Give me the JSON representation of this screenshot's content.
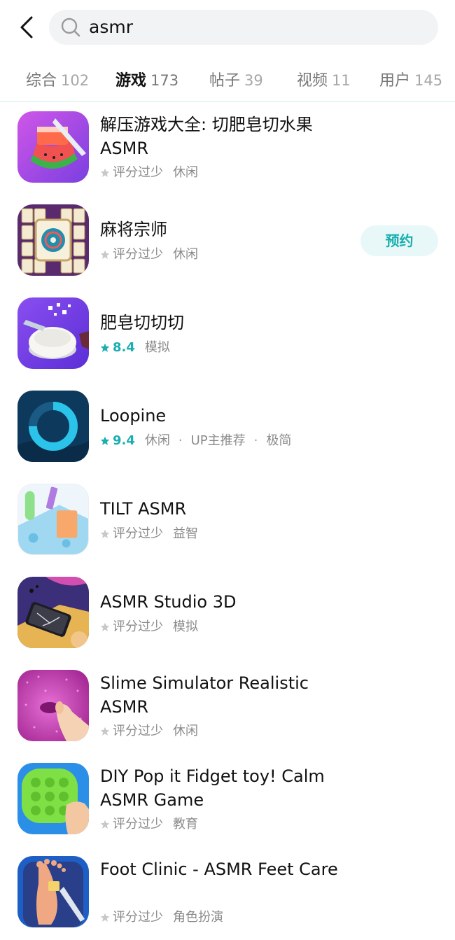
{
  "search": {
    "value": "asmr"
  },
  "tabs": [
    {
      "label": "综合",
      "count": "102"
    },
    {
      "label": "游戏",
      "count": "173"
    },
    {
      "label": "帖子",
      "count": "39"
    },
    {
      "label": "视频",
      "count": "11"
    },
    {
      "label": "用户",
      "count": "145"
    }
  ],
  "active_tab_index": 1,
  "accent_color": "#1aaeb0",
  "items": [
    {
      "name": "解压游戏大全: 切肥皂切水果 ASMR",
      "rating_text": "评分过少",
      "tags": [
        "休闲"
      ],
      "icon": "watermelon-cut-icon"
    },
    {
      "name": "麻将宗师",
      "rating_text": "评分过少",
      "tags": [
        "休闲"
      ],
      "action": "预约",
      "icon": "mahjong-icon"
    },
    {
      "name": "肥皂切切切",
      "rating": "8.4",
      "tags": [
        "模拟"
      ],
      "icon": "soap-cut-icon"
    },
    {
      "name": "Loopine",
      "rating": "9.4",
      "tags": [
        "休闲",
        "UP主推荐",
        "极简"
      ],
      "icon": "loop-ring-icon"
    },
    {
      "name": "TILT ASMR",
      "rating_text": "评分过少",
      "tags": [
        "益智"
      ],
      "icon": "tilt-blocks-icon"
    },
    {
      "name": "ASMR Studio 3D",
      "rating_text": "评分过少",
      "tags": [
        "模拟"
      ],
      "icon": "phone-crush-icon"
    },
    {
      "name": "Slime Simulator Realistic ASMR",
      "rating_text": "评分过少",
      "tags": [
        "休闲"
      ],
      "icon": "slime-icon"
    },
    {
      "name": "DIY Pop it Fidget toy! Calm ASMR Game",
      "rating_text": "评分过少",
      "tags": [
        "教育"
      ],
      "icon": "pop-it-icon"
    },
    {
      "name": "Foot Clinic - ASMR Feet Care",
      "rating_text": "评分过少",
      "tags": [
        "角色扮演"
      ],
      "icon": "foot-care-icon"
    }
  ]
}
